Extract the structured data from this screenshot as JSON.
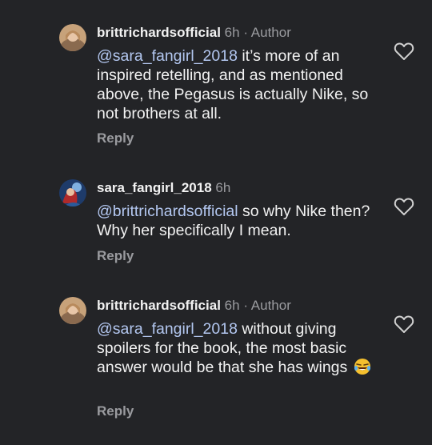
{
  "comments": [
    {
      "username": "brittrichardsofficial",
      "time": "6h",
      "separator": "·",
      "badge": "Author",
      "mention": "@sara_fangirl_2018",
      "text": " it’s more of an inspired retelling, and as mentioned above, the Pegasus is actually Nike, so not brothers at all.",
      "reply_label": "Reply"
    },
    {
      "username": "sara_fangirl_2018",
      "time": "6h",
      "mention": "@brittrichardsofficial",
      "text": " so why Nike then? Why her specifically I mean.",
      "reply_label": "Reply"
    },
    {
      "username": "brittrichardsofficial",
      "time": "6h",
      "separator": "·",
      "badge": "Author",
      "mention": "@sara_fangirl_2018",
      "text": " without giving spoilers for the book, the most basic answer would be that she has wings",
      "emoji": "laughing-tears-emoji",
      "reply_label": "Reply"
    }
  ],
  "colors": {
    "background": "#232427",
    "text": "#f2f2f2",
    "muted": "#9a9b9f",
    "mention": "#b3c7f0"
  }
}
